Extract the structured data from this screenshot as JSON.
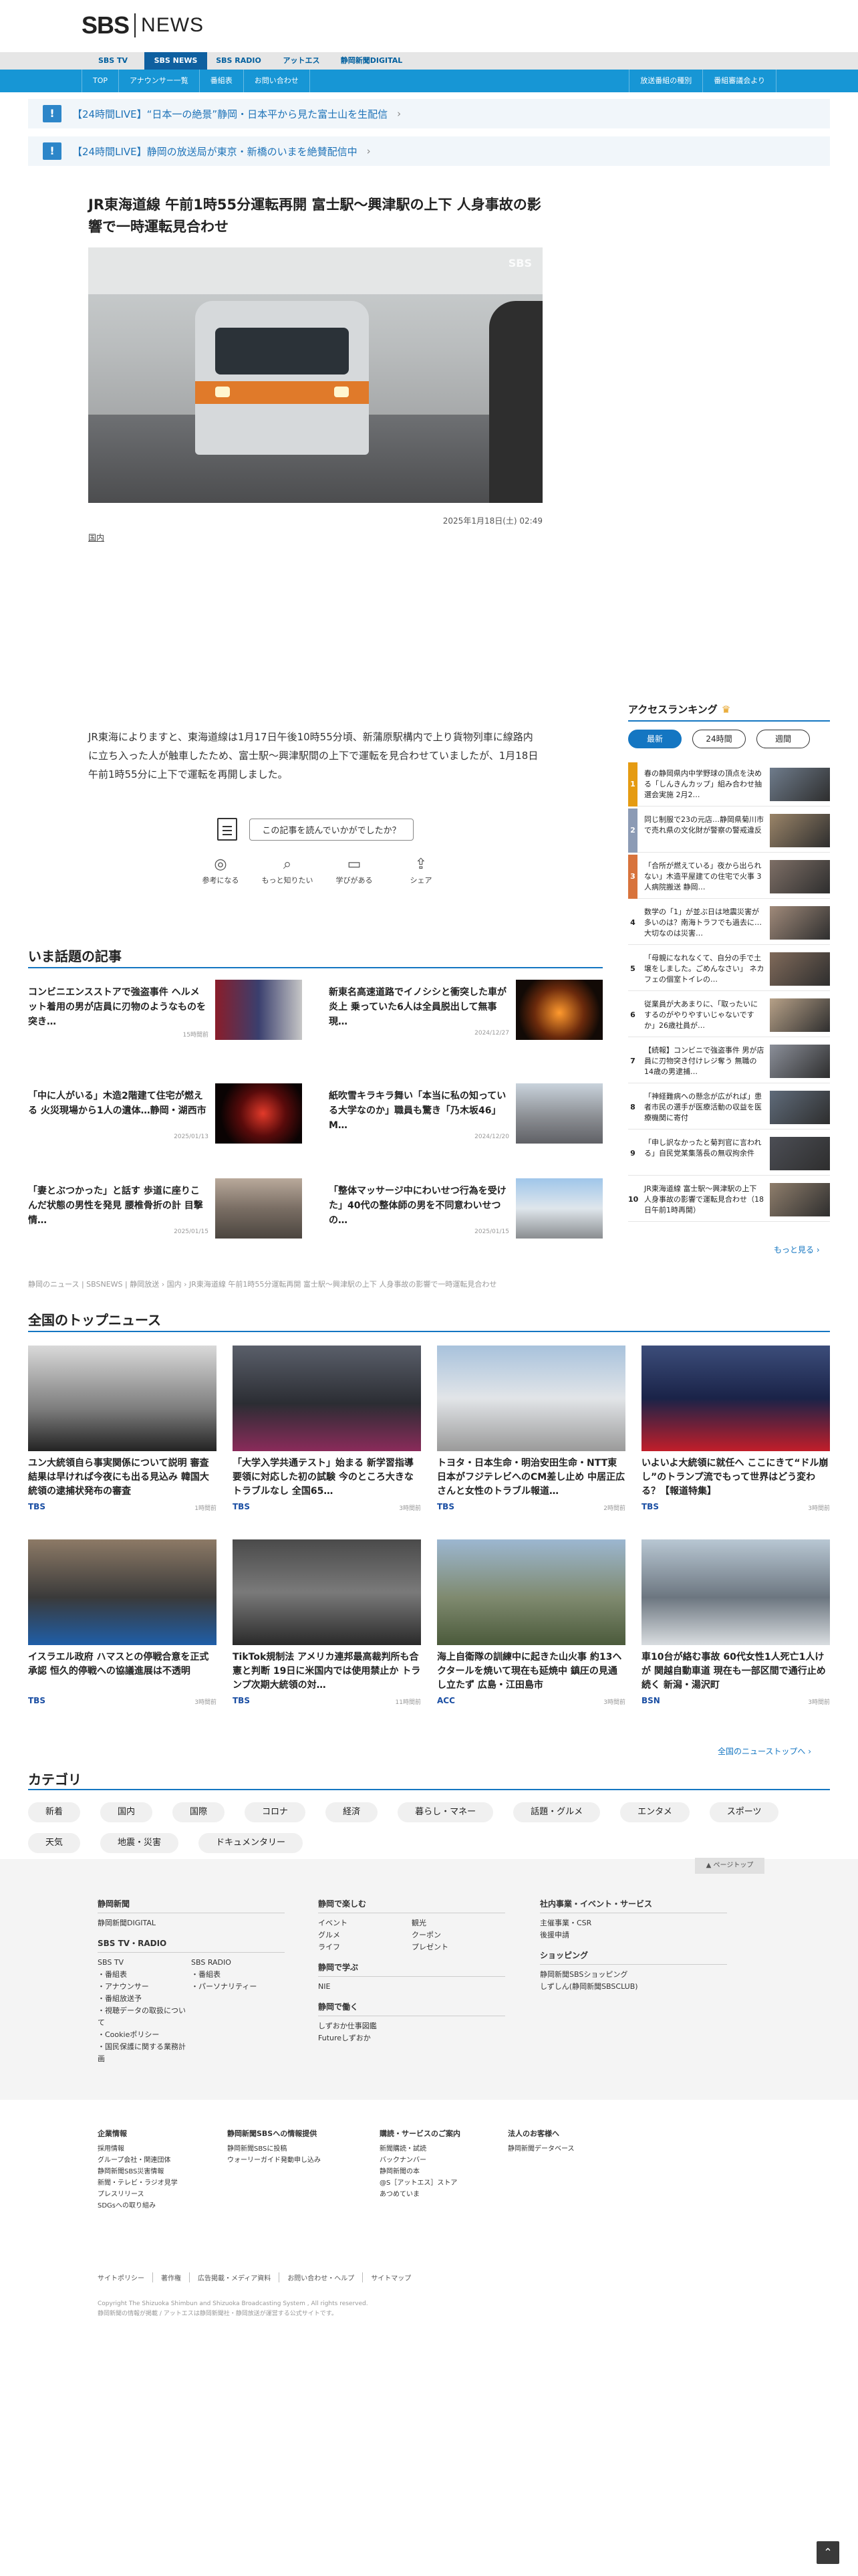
{
  "brand": {
    "sbs": "SBS",
    "news": "NEWS"
  },
  "nav1": [
    "SBS TV",
    "SBS NEWS",
    "SBS RADIO",
    "アットエス",
    "静岡新聞DIGITAL"
  ],
  "nav2_left": [
    "TOP",
    "アナウンサー一覧",
    "番組表",
    "お問い合わせ"
  ],
  "nav2_right": [
    "放送番組の種別",
    "番組審議会より"
  ],
  "alerts": [
    "【24時間LIVE】“日本一の絶景”静岡・日本平から見た富士山を生配信",
    "【24時間LIVE】静岡の放送局が東京・新橋のいまを絶賛配信中"
  ],
  "article": {
    "title": "JR東海道線 午前1時55分運転再開 富士駅～興津駅の上下 人身事故の影響で一時運転見合わせ",
    "watermark": "SBS",
    "date": "2025年1月18日(土) 02:49",
    "category": "国内",
    "body": "JR東海によりますと、東海道線は1月17日午後10時55分頃、新蒲原駅構内で上り貨物列車に線路内に立ち入った人が触車したため、富士駅～興津駅間の上下で運転を見合わせていましたが、1月18日午前1時55分に上下で運転を再開しました。",
    "feedback_q": "この記事を読んでいかがでしたか？",
    "reactions": [
      "参考になる",
      "もっと知りたい",
      "学びがある",
      "シェア"
    ]
  },
  "trending": {
    "title": "いま話題の記事",
    "items": [
      {
        "title": "コンビニエンスストアで強盗事件 ヘルメット着用の男が店員に刃物のようなものを突き…",
        "date": "15時間前"
      },
      {
        "title": "新東名高速道路でイノシシと衝突した車が炎上 乗っていた6人は全員脱出して無事 現…",
        "date": "2024/12/27"
      },
      {
        "title": "「中に人がいる」木造2階建て住宅が燃える 火災現場から1人の遺体…静岡・湖西市",
        "date": "2025/01/13"
      },
      {
        "title": "紙吹雪キラキラ舞い「本当に私の知っている大学なのか」職員も驚き「乃木坂46」M…",
        "date": "2024/12/20"
      },
      {
        "title": "「妻とぶつかった」と話す 歩道に座りこんだ状態の男性を発見 腰椎骨折の計 目撃情…",
        "date": "2025/01/15"
      },
      {
        "title": "「整体マッサージ中にわいせつ行為を受けた」40代の整体師の男を不同意わいせつの…",
        "date": "2025/01/15"
      }
    ]
  },
  "ranking": {
    "title": "アクセスランキング",
    "crown": "♛",
    "tabs": [
      "最新",
      "24時間",
      "週間"
    ],
    "items": [
      "春の静岡県内中学野球の頂点を決める「しんきんカップ」組み合わせ抽選会実施 2月2…",
      "同じ制服で23の元店…静岡県菊川市で売れ県の文化財が警察の警戒違反",
      "「合所が燃えている」夜から出られない」木造平屋建ての住宅で火事 3人病院搬送 静岡…",
      "数学の「1」が並ぶ日は地震災害が多いのは？南海トラフでも過去に…大切なのは災害…",
      "「母親になれなくて、自分の手で土壌をしました。ごめんなさい」 ネカフェの個室トイレの…",
      "従業員が大あまりに、「取ったいにするのがやりやすいじゃないですか」26歳社員が…",
      "【続報】コンビニで強盗事件 男が店員に刃物突き付けレジ奪う 無職の14歳の男逮捕…",
      "「神経難病への懸念が広がれば」患者市民の選手が医療活動の収益を医療機関に寄付",
      "「申し訳なかったと菊判官に言われる」自民党某集落長の無収拘余件",
      "JR東海道線 富士駅～興津駅の上下 人身事故の影響で運転見合わせ（18日午前1時再開）"
    ],
    "more": "もっと見る ›"
  },
  "breadcrumb": "静岡のニュース | SBSNEWS | 静岡放送 › 国内 › JR東海道線 午前1時55分運転再開 富士駅～興津駅の上下 人身事故の影響で一時運転見合わせ",
  "national": {
    "title": "全国のトップニュース",
    "items": [
      {
        "title": "ユン大統領自ら事実関係について説明 審査結果は早ければ今夜にも出る見込み 韓国大統領の逮捕状発布の審査",
        "src": "TBS",
        "date": "1時間前"
      },
      {
        "title": "「大学入学共通テスト」始まる 新学習指導要領に対応した初の試験 今のところ大きなトラブルなし 全国65…",
        "src": "TBS",
        "date": "3時間前"
      },
      {
        "title": "トヨタ・日本生命・明治安田生命・NTT東日本がフジテレビへのCM差し止め 中居正広さんと女性のトラブル報道…",
        "src": "TBS",
        "date": "2時間前"
      },
      {
        "title": "いよいよ大統領に就任へ ここにきて“ドル崩し”のトランプ流でもって世界はどう変わる？【報道特集】",
        "src": "TBS",
        "date": "3時間前"
      },
      {
        "title": "イスラエル政府 ハマスとの停戦合意を正式承認 恒久的停戦への協議進展は不透明",
        "src": "TBS",
        "date": "3時間前"
      },
      {
        "title": "TikTok規制法 アメリカ連邦最高裁判所も合憲と判断 19日に米国内では使用禁止か トランプ次期大統領の対…",
        "src": "TBS",
        "date": "11時間前"
      },
      {
        "title": "海上自衛隊の訓練中に起きた山火事 約13ヘクタールを焼いて現在も延焼中 鎮圧の見通し立たず 広島・江田島市",
        "src": "ACC",
        "date": "3時間前"
      },
      {
        "title": "車10台が絡む事故 60代女性1人死亡1人けが 関越自動車道 現在も一部区間で通行止め続く 新潟・湯沢町",
        "src": "BSN",
        "date": "3時間前"
      }
    ],
    "more": "全国のニューストップへ ›"
  },
  "categories": {
    "title": "カテゴリ",
    "items": [
      "新着",
      "国内",
      "国際",
      "コロナ",
      "経済",
      "暮らし・マネー",
      "話題・グルメ",
      "エンタメ",
      "スポーツ",
      "天気",
      "地震・災害",
      "ドキュメンタリー"
    ]
  },
  "footer": {
    "pagetop": "▲ ページトップ",
    "col1": {
      "h": "静岡新聞",
      "items": [
        "静岡新聞DIGITAL"
      ]
    },
    "col1b": {
      "h": "SBS TV・RADIO",
      "tv": [
        "SBS TV",
        "・番組表",
        "・アナウンサー",
        "・番組放送予",
        "・視聴データの取扱について",
        "・Cookieポリシー",
        "・国民保護に関する業務計画"
      ],
      "radio": [
        "SBS RADIO",
        "・番組表",
        "・パーソナリティー"
      ]
    },
    "col2": {
      "h": "静岡で楽しむ",
      "items": [
        "イベント",
        "グルメ",
        "ライフ"
      ],
      "items2": [
        "観光",
        "クーポン",
        "プレゼント"
      ]
    },
    "col2b": {
      "h": "静岡で学ぶ",
      "items": [
        "NIE"
      ]
    },
    "col2c": {
      "h": "静岡で働く",
      "items": [
        "しずおか仕事図鑑",
        "Futureしずおか"
      ]
    },
    "col3": {
      "h": "社内事業・イベント・サービス",
      "items": [
        "主催事業・CSR",
        "後援申請"
      ]
    },
    "col3b": {
      "h": "ショッピング",
      "items": [
        "静岡新聞SBSショッピング",
        "しずしん(静岡新聞SBSCLUB)"
      ]
    },
    "b1": {
      "h": "企業情報",
      "items": [
        "採用情報",
        "グループ会社・関連団体",
        "静岡新聞SBS災害情報",
        "新聞・テレビ・ラジオ見学",
        "プレスリリース",
        "SDGsへの取り組み"
      ]
    },
    "b2": {
      "h": "静岡新聞SBSへの情報提供",
      "items": [
        "静岡新聞SBSに投稿",
        "ウォーリーガイド発動申し込み"
      ]
    },
    "b3": {
      "h": "購読・サービスのご案内",
      "items": [
        "新聞購読・試読",
        "バックナンバー",
        "静岡新聞の本",
        "@S［アットエス］ストア",
        "あつめていま"
      ]
    },
    "b4": {
      "h": "法人のお客様へ",
      "items": [
        "静岡新聞データベース"
      ]
    },
    "links": [
      "サイトポリシー",
      "著作権",
      "広告掲載・メディア資料",
      "お問い合わせ・ヘルプ",
      "サイトマップ"
    ],
    "copyright": "Copyright The Shizuoka Shimbun and Shizuoka Broadcasting System , All rights reserved.",
    "copyright2": "静岡新聞の情報が掲載 / アットエスは静岡新聞社・静岡放送が運営する公式サイトです。"
  }
}
